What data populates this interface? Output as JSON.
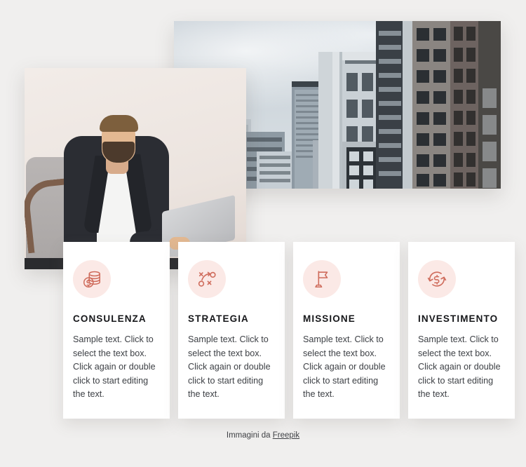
{
  "page": {
    "background_color": "#f0efee",
    "accent_color": "#cf6c5c",
    "icon_badge_color": "#fbe9e6"
  },
  "media": {
    "buildings": {
      "alt": "city skyscrapers under cloudy sky",
      "name": "buildings-photo"
    },
    "man": {
      "alt": "bearded businessman in dark blazer working on a laptop",
      "name": "businessman-photo"
    }
  },
  "cards": [
    {
      "icon": "coins-icon",
      "title": "CONSULENZA",
      "text": "Sample text. Click to select the text box. Click again or double click to start editing the text."
    },
    {
      "icon": "strategy-playbook-icon",
      "title": "STRATEGIA",
      "text": "Sample text. Click to select the text box. Click again or double click to start editing the text."
    },
    {
      "icon": "flag-icon",
      "title": "MISSIONE",
      "text": "Sample text. Click to select the text box. Click again or double click to start editing the text."
    },
    {
      "icon": "money-exchange-icon",
      "title": "INVESTIMENTO",
      "text": "Sample text. Click to select the text box. Click again or double click to start editing the text."
    }
  ],
  "footer": {
    "prefix": "Immagini da ",
    "link_label": "Freepik"
  }
}
